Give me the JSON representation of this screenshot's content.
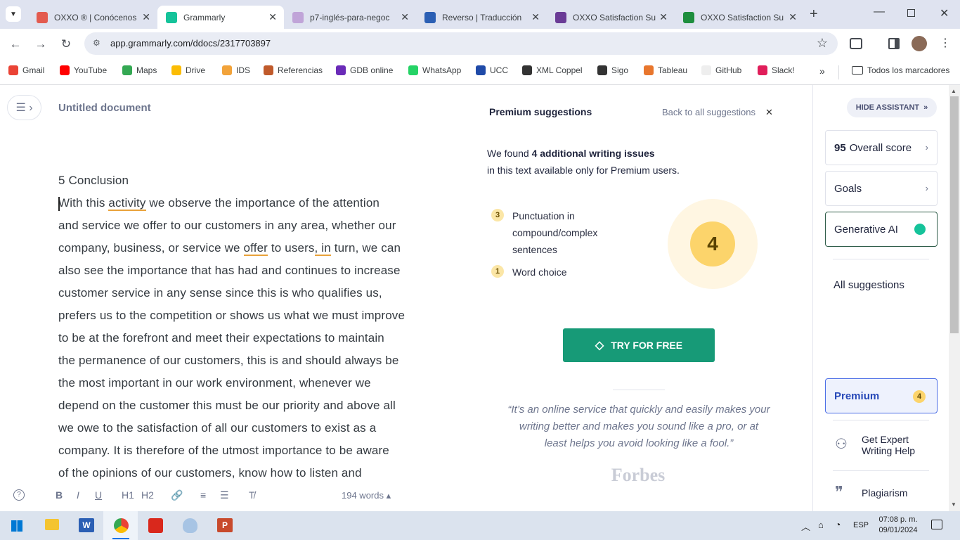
{
  "browser": {
    "tabs": [
      {
        "title": "OXXO ® | Conócenos",
        "color": "#e35b4f"
      },
      {
        "title": "Grammarly",
        "color": "#15c39a"
      },
      {
        "title": "p7-inglés-para-negoc",
        "color": "#c0a4d8"
      },
      {
        "title": "Reverso | Traducción",
        "color": "#2b5fb4"
      },
      {
        "title": "OXXO Satisfaction Su",
        "color": "#6a3b96"
      },
      {
        "title": "OXXO Satisfaction Su",
        "color": "#1e8e3e"
      }
    ],
    "url": "app.grammarly.com/ddocs/2317703897",
    "bookmarks": [
      {
        "label": "Gmail",
        "color": "#ea4335"
      },
      {
        "label": "YouTube",
        "color": "#ff0000"
      },
      {
        "label": "Maps",
        "color": "#34a853"
      },
      {
        "label": "Drive",
        "color": "#fbbc04"
      },
      {
        "label": "IDS",
        "color": "#f2a33a"
      },
      {
        "label": "Referencias",
        "color": "#c05a2b"
      },
      {
        "label": "GDB online",
        "color": "#6a2bb8"
      },
      {
        "label": "WhatsApp",
        "color": "#25d366"
      },
      {
        "label": "UCC",
        "color": "#1f4aa8"
      },
      {
        "label": "XML Coppel",
        "color": "#333333"
      },
      {
        "label": "Sigo",
        "color": "#333333"
      },
      {
        "label": "Tableau",
        "color": "#e8762d"
      },
      {
        "label": "GitHub",
        "color": "#eeeeee"
      },
      {
        "label": "Slack!",
        "color": "#e01e5a"
      }
    ],
    "all_bookmarks": "Todos los marcadores"
  },
  "doc": {
    "title": "Untitled document",
    "heading": "5 Conclusion",
    "word_count": "194 words",
    "lines": [
      [
        "With this ",
        "activity",
        " we observe the importance of the attention"
      ],
      [
        "and service we offer to our customers in any area, whether our"
      ],
      [
        "company, business, or service we ",
        "offer",
        " to users",
        ", in",
        " turn, we can"
      ],
      [
        "also see the importance that has had and continues to increase"
      ],
      [
        "customer service in any sense since this is who qualifies us,"
      ],
      [
        "prefers us to the competition or shows us what we must improve"
      ],
      [
        "to be at the forefront and meet their expectations to maintain"
      ],
      [
        "the permanence of our customers, this is and should always be"
      ],
      [
        "the most important in our work environment, whenever we"
      ],
      [
        "depend on the customer this must be our priority and above all"
      ],
      [
        "we owe to the satisfaction of all our customers to exist as a"
      ],
      [
        "company. It is therefore of the utmost importance to be aware"
      ],
      [
        "of the opinions of our customers, know how to listen and"
      ]
    ],
    "format_buttons": [
      "B",
      "I",
      "U",
      "H1",
      "H2"
    ]
  },
  "panel": {
    "header": "Premium suggestions",
    "back": "Back to all suggestions",
    "found_prefix": "We found ",
    "found_bold": "4 additional writing issues",
    "found_suffix": "in this text available only for Premium users.",
    "issues": [
      {
        "count": "3",
        "label": "Punctuation in compound/complex sentences"
      },
      {
        "count": "1",
        "label": "Word choice"
      }
    ],
    "total": "4",
    "cta": "TRY FOR FREE",
    "quote": "“It’s an online service that quickly and easily makes your writing better and makes you sound like a pro, or at least helps you avoid looking like a fool.”",
    "quote_source": "Forbes"
  },
  "sidebar": {
    "hide": "HIDE ASSISTANT",
    "score": "95",
    "score_label": "Overall score",
    "goals": "Goals",
    "gen_ai": "Generative AI",
    "all_suggestions": "All suggestions",
    "premium": "Premium",
    "premium_count": "4",
    "expert": "Get Expert Writing Help",
    "plagiarism": "Plagiarism"
  },
  "taskbar": {
    "lang": "ESP",
    "time": "07:08 p. m.",
    "date": "09/01/2024"
  }
}
